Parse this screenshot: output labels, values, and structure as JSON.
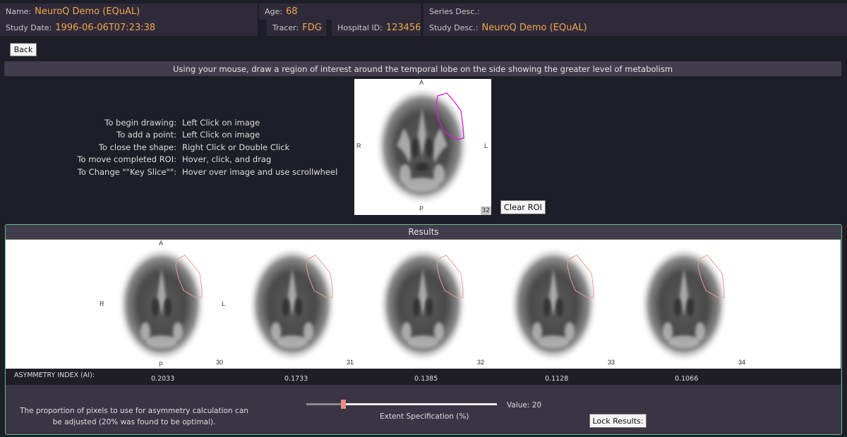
{
  "header": {
    "name_label": "Name:",
    "name_value": "NeuroQ Demo (EQuAL)",
    "age_label": "Age:",
    "age_value": "68",
    "series_label": "Series Desc.:",
    "series_value": "",
    "study_date_label": "Study Date:",
    "study_date_value": "1996-06-06T07:23:38",
    "tracer_label": "Tracer:",
    "tracer_value": "FDG",
    "hospital_label": "Hospital ID:",
    "hospital_value": "123456",
    "study_desc_label": "Study Desc.:",
    "study_desc_value": "NeuroQ Demo (EQuAL)"
  },
  "back_label": "Back",
  "instruction": "Using your mouse, draw a region of interest around the temporal lobe on the side showing the greater level of metabolism",
  "steps": [
    {
      "label": "To begin drawing:",
      "text": "Left Click on image"
    },
    {
      "label": "To add a point:",
      "text": "Left Click on image"
    },
    {
      "label": "To close the shape:",
      "text": "Right Click or Double Click"
    },
    {
      "label": "To move completed ROI:",
      "text": "Hover, click, and drag"
    },
    {
      "label": "To Change \"\"Key Slice\"\":",
      "text": "Hover over image and use scrollwheel"
    }
  ],
  "main_image": {
    "orient_a": "A",
    "orient_p": "P",
    "orient_r": "R",
    "orient_l": "L",
    "slice": "32",
    "roi_color": "#d81fd0"
  },
  "clear_roi_label": "Clear ROI",
  "results": {
    "title": "Results",
    "orient_a": "A",
    "orient_p": "P",
    "orient_r": "R",
    "orient_l": "L",
    "slices": [
      "30",
      "31",
      "32",
      "33",
      "34"
    ],
    "ai_label": "ASYMMETRY INDEX (AI):",
    "ai_values": [
      "0.2033",
      "0.1733",
      "0.1385",
      "0.1128",
      "0.1066"
    ],
    "roi_color": "#e8a090"
  },
  "bottom": {
    "note": "The proportion of pixels to use for asymmetry calculation can be adjusted (20% was found to be optimal).",
    "slider_label": "Extent Specification (%)",
    "value_label": "Value: 20",
    "slider_value_percent": 20,
    "lock_label": "Lock Results:"
  },
  "colors": {
    "accent": "#f0a64a",
    "results_border": "#5cc27c",
    "slider_thumb": "#f08a84"
  }
}
